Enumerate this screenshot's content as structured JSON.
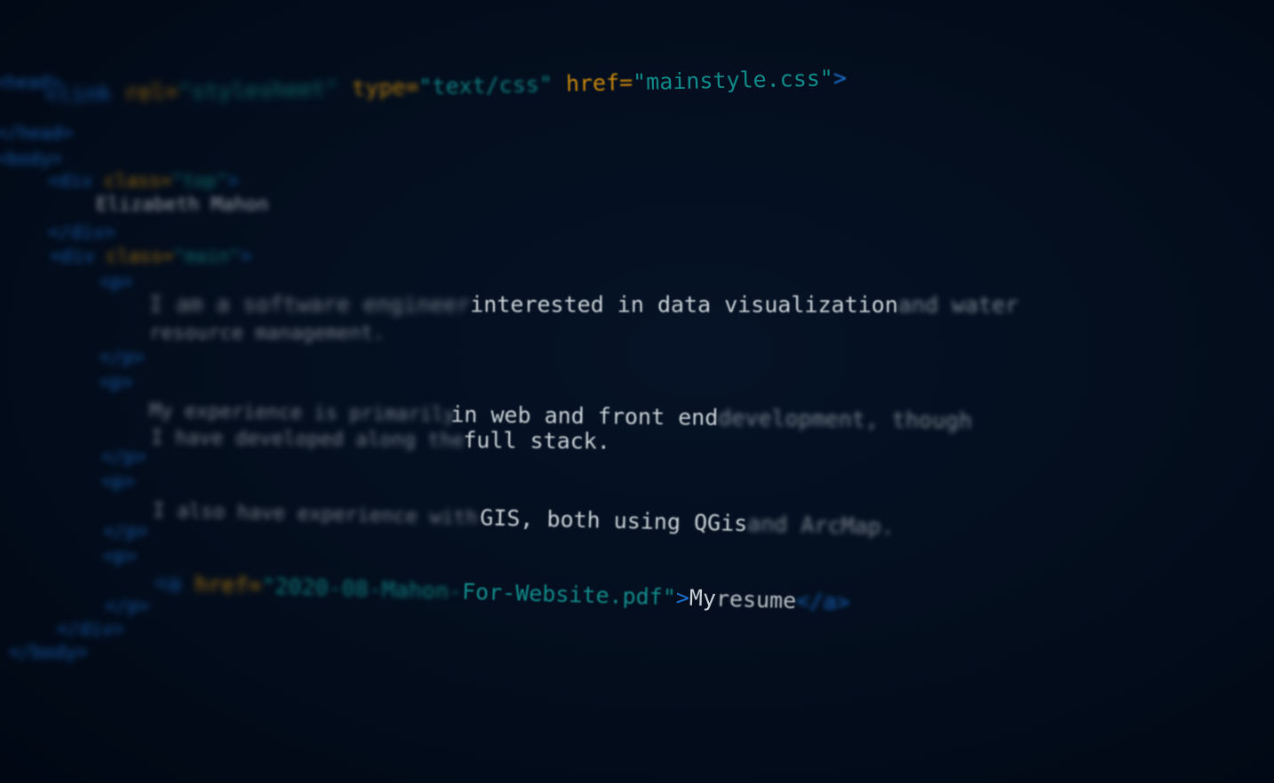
{
  "code_lines": {
    "head_open": "<head>",
    "link_tag_open": "<link",
    "link_rel_attr": "rel=",
    "link_rel_val": "\"stylesheet\"",
    "link_type_attr": "type=",
    "link_type_val": "\"text/css\"",
    "link_href_attr": "href=",
    "link_href_val": "\"mainstyle.css\"",
    "link_close": ">",
    "head_close": "</head>",
    "body_open": "<body>",
    "div_top_open": "<div",
    "div_top_class_attr": "class=",
    "div_top_class_val": "\"top\"",
    "div_top_gt": ">",
    "name_text": "Elizabeth Mahon",
    "div_top_close": "</div>",
    "div_main_open": "<div",
    "div_main_class_attr": "class=",
    "div_main_class_val": "\"main\"",
    "div_main_gt": ">",
    "p1_open": "<p>",
    "p1_text_a": "I am a software engineer ",
    "p1_text_b": "interested in data visualization",
    "p1_text_c": " and water",
    "p1_text_line2": "resource management.",
    "p1_close": "</p>",
    "p2_open": "<p>",
    "p2_text_a": "My experience is primarily ",
    "p2_text_b": "in web and front end",
    "p2_text_c": " development, though",
    "p2_text_line2a": "I have developed along the ",
    "p2_text_line2b": "full stack.",
    "p2_close": "</p>",
    "p3_open": "<p>",
    "p3_text_a": "I also have experience with ",
    "p3_text_b": "GIS, both using QGis",
    "p3_text_c": " and ArcMap.",
    "p3_close": "</p>",
    "p4_open": "<p>",
    "a_open": "<a",
    "a_href_attr": "href=",
    "a_href_val_a": "\"2020-08-Mahon-",
    "a_href_val_b": "For-Website.pdf\"",
    "a_gt": ">",
    "a_text_a": "My ",
    "a_text_b": "resume",
    "a_close": "</a>",
    "p4_close": "</p>",
    "div_main_close": "</div>",
    "body_close": "</body>"
  },
  "colors": {
    "background": "#020b18",
    "tag": "#1a6fd0",
    "attribute": "#c8860a",
    "string": "#118a8a",
    "text": "#b9c0c6"
  }
}
